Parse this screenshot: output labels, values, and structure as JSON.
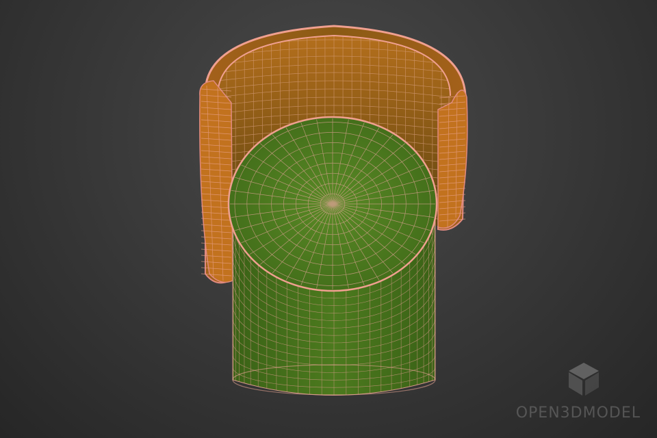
{
  "scene": {
    "description_colors": {
      "background": "#3a3a3a",
      "backrest_fill": "#c07020",
      "backrest_inner_dark": "#6a4a10",
      "backrest_edge": "#e08a80",
      "seat_fill": "#4c7a1e",
      "seat_side_fill": "#3f6a18",
      "wire": "#d89a8a"
    },
    "object_name": "wireframe-chair-model"
  },
  "watermark": {
    "text": "OPEN3DMODEL",
    "logo": "cube-icon"
  }
}
